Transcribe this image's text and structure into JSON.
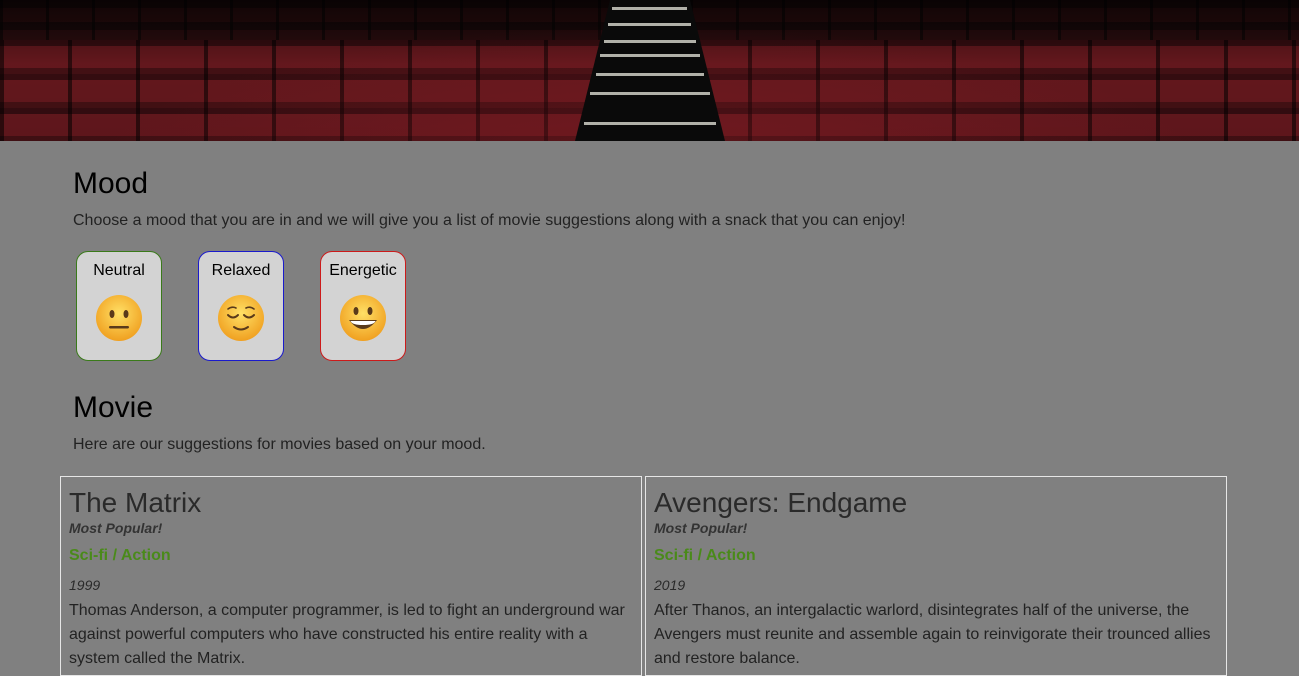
{
  "mood": {
    "title": "Mood",
    "description": "Choose a mood that you are in and we will give you a list of movie suggestions along with a snack that you can enjoy!",
    "options": [
      {
        "label": "Neutral",
        "icon": "neutral-face-icon",
        "border": "#3a7a1a"
      },
      {
        "label": "Relaxed",
        "icon": "relieved-face-icon",
        "border": "#1a1acc"
      },
      {
        "label": "Energetic",
        "icon": "grinning-face-icon",
        "border": "#cc1a1a"
      }
    ]
  },
  "movie": {
    "title": "Movie",
    "description": "Here are our suggestions for movies based on your mood.",
    "cards": [
      {
        "title": "The Matrix",
        "badge": "Most Popular!",
        "genre": "Sci-fi / Action",
        "year": "1999",
        "description": "Thomas Anderson, a computer programmer, is led to fight an underground war against powerful computers who have constructed his entire reality with a system called the Matrix."
      },
      {
        "title": "Avengers: Endgame",
        "badge": "Most Popular!",
        "genre": "Sci-fi / Action",
        "year": "2019",
        "description": "After Thanos, an intergalactic warlord, disintegrates half of the universe, the Avengers must reunite and assemble again to reinvigorate their trounced allies and restore balance."
      }
    ]
  },
  "colors": {
    "page_background": "#808080",
    "card_background": "#d3d3d3",
    "genre_green": "#4a8a1a"
  }
}
